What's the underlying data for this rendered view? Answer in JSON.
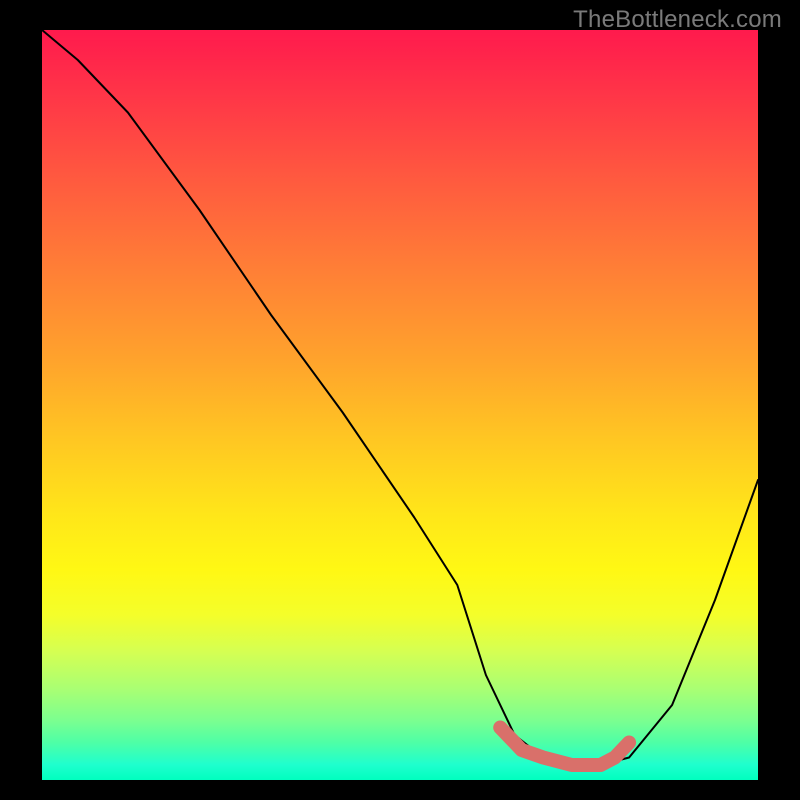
{
  "watermark": {
    "text": "TheBottleneck.com"
  },
  "chart_data": {
    "type": "line",
    "title": "",
    "xlabel": "",
    "ylabel": "",
    "xlim": [
      0,
      100
    ],
    "ylim": [
      0,
      100
    ],
    "series": [
      {
        "name": "bottleneck-curve",
        "x": [
          0,
          5,
          12,
          22,
          32,
          42,
          52,
          58,
          62,
          66,
          70,
          74,
          78,
          82,
          88,
          94,
          100
        ],
        "y": [
          100,
          96,
          89,
          76,
          62,
          49,
          35,
          26,
          14,
          6,
          3,
          2,
          2,
          3,
          10,
          24,
          40
        ]
      }
    ],
    "highlight_segment": {
      "name": "optimal-range",
      "x": [
        64,
        67,
        70,
        74,
        78,
        80,
        82
      ],
      "y": [
        7,
        4,
        3,
        2,
        2,
        3,
        5
      ]
    },
    "background_gradient": {
      "top": "#ff1a4d",
      "mid": "#ffe719",
      "bottom": "#00ffbf"
    }
  }
}
